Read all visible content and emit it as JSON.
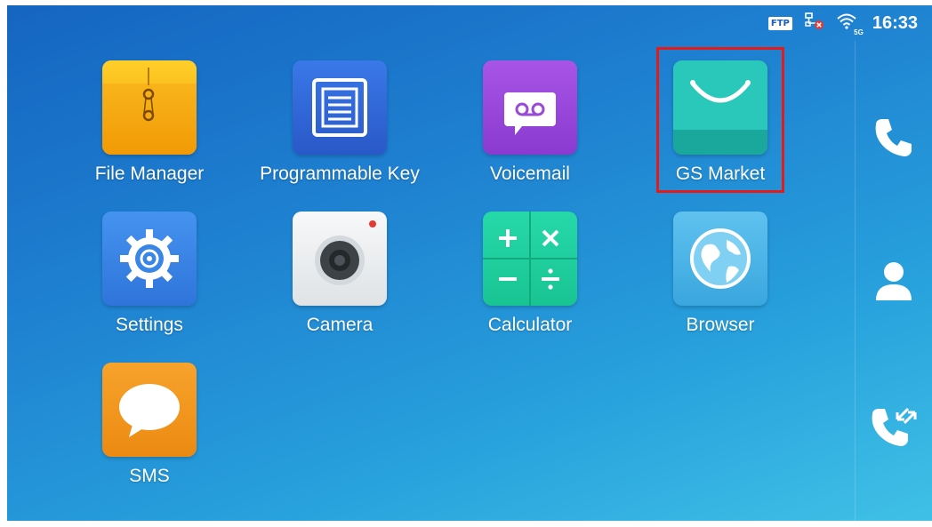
{
  "status_bar": {
    "ftp_badge": "FTP",
    "network_icon": "network-disconnected-icon",
    "wifi_icon": "wifi-5g-icon",
    "wifi_band": "5G",
    "time": "16:33"
  },
  "apps": [
    {
      "label": "File Manager",
      "icon": "file-manager-icon"
    },
    {
      "label": "Programmable Key",
      "icon": "programmable-key-icon"
    },
    {
      "label": "Voicemail",
      "icon": "voicemail-icon"
    },
    {
      "label": "GS Market",
      "icon": "gs-market-icon",
      "highlighted": true
    },
    {
      "label": "Settings",
      "icon": "settings-gear-icon"
    },
    {
      "label": "Camera",
      "icon": "camera-icon"
    },
    {
      "label": "Calculator",
      "icon": "calculator-icon"
    },
    {
      "label": "Browser",
      "icon": "globe-icon"
    },
    {
      "label": "SMS",
      "icon": "sms-bubble-icon"
    }
  ],
  "sidebar": {
    "buttons": [
      {
        "name": "phone-icon"
      },
      {
        "name": "contacts-icon"
      },
      {
        "name": "call-history-icon"
      }
    ]
  },
  "colors": {
    "highlight": "#e31b1b",
    "file_manager": "#f5b400",
    "programmable_key": "#2f66d8",
    "voicemail": "#9a4ad8",
    "gs_market": "#20b8ad",
    "settings": "#3a86e8",
    "camera": "#eceff1",
    "calculator": "#21cfa0",
    "browser": "#53b6e6",
    "sms": "#f29a1f"
  }
}
